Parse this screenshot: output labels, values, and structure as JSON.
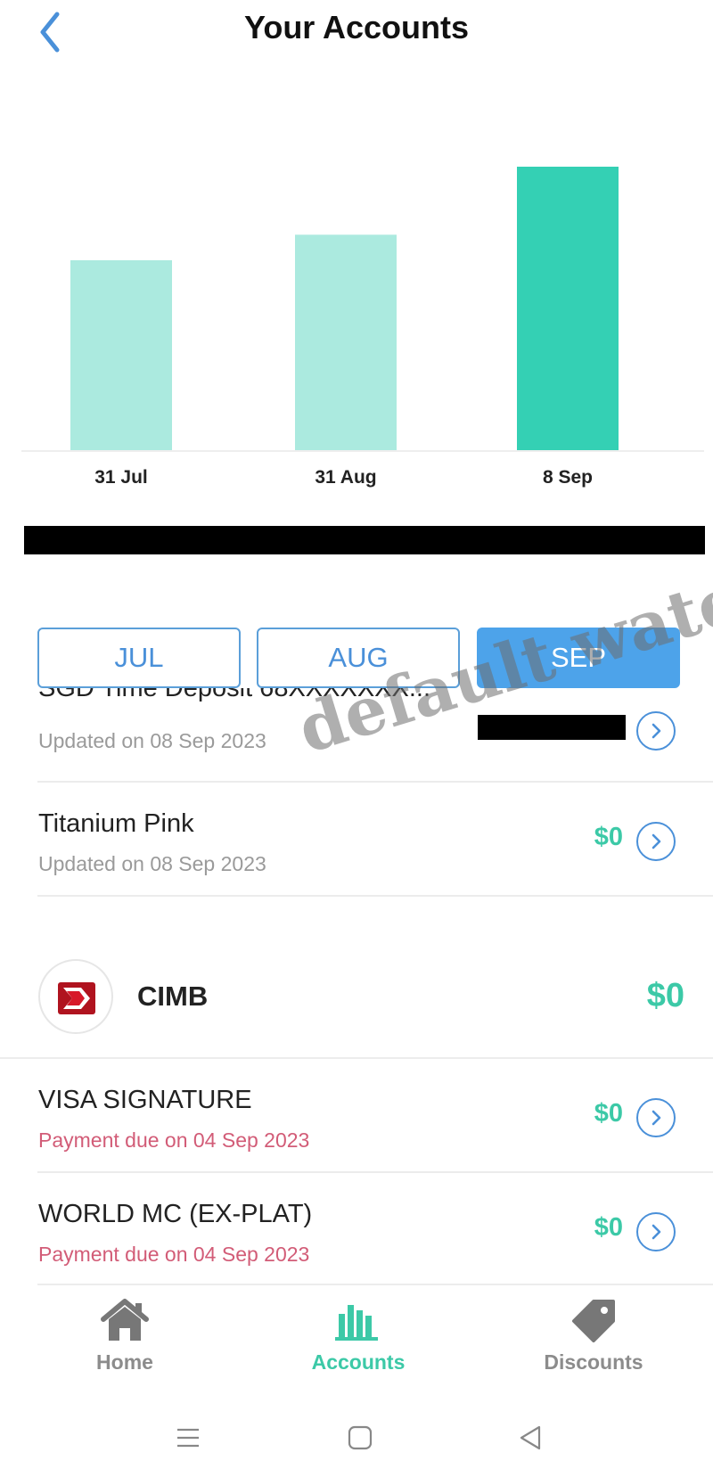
{
  "header": {
    "title": "Your Accounts"
  },
  "chart_data": {
    "type": "bar",
    "categories": [
      "31 Jul",
      "31 Aug",
      "8 Sep"
    ],
    "values": [
      0.67,
      0.76,
      1.0
    ],
    "highlight_index": 2,
    "colors": {
      "bar": "#abeadf",
      "highlight": "#34d0b4"
    },
    "grid": false
  },
  "month_tabs": [
    {
      "label": "JUL",
      "active": false
    },
    {
      "label": "AUG",
      "active": false
    },
    {
      "label": "SEP",
      "active": true
    }
  ],
  "accounts": [
    {
      "name": "SGD Time Deposit 68XXXXXXX...",
      "subtitle": "Updated on 08 Sep 2023"
    },
    {
      "name": "Titanium Pink",
      "subtitle": "Updated on 08 Sep 2023",
      "value": "$0"
    }
  ],
  "bank": {
    "name": "CIMB",
    "total": "$0"
  },
  "cimb_accounts": [
    {
      "name": "VISA SIGNATURE",
      "subtitle": "Payment due on 04 Sep 2023",
      "value": "$0"
    },
    {
      "name": "WORLD MC (EX-PLAT)",
      "subtitle": "Payment due on 04 Sep 2023",
      "value": "$0"
    }
  ],
  "nav": [
    {
      "label": "Home",
      "icon": "home-icon",
      "active": false
    },
    {
      "label": "Accounts",
      "icon": "bar-chart-icon",
      "active": true
    },
    {
      "label": "Discounts",
      "icon": "tag-icon",
      "active": false
    }
  ],
  "system_nav": [
    "menu-icon",
    "home-square-icon",
    "back-triangle-icon"
  ],
  "watermark": "default watermark",
  "colors": {
    "accent": "#4da3ea",
    "positive": "#3cc9a7",
    "due": "#d25c77"
  }
}
